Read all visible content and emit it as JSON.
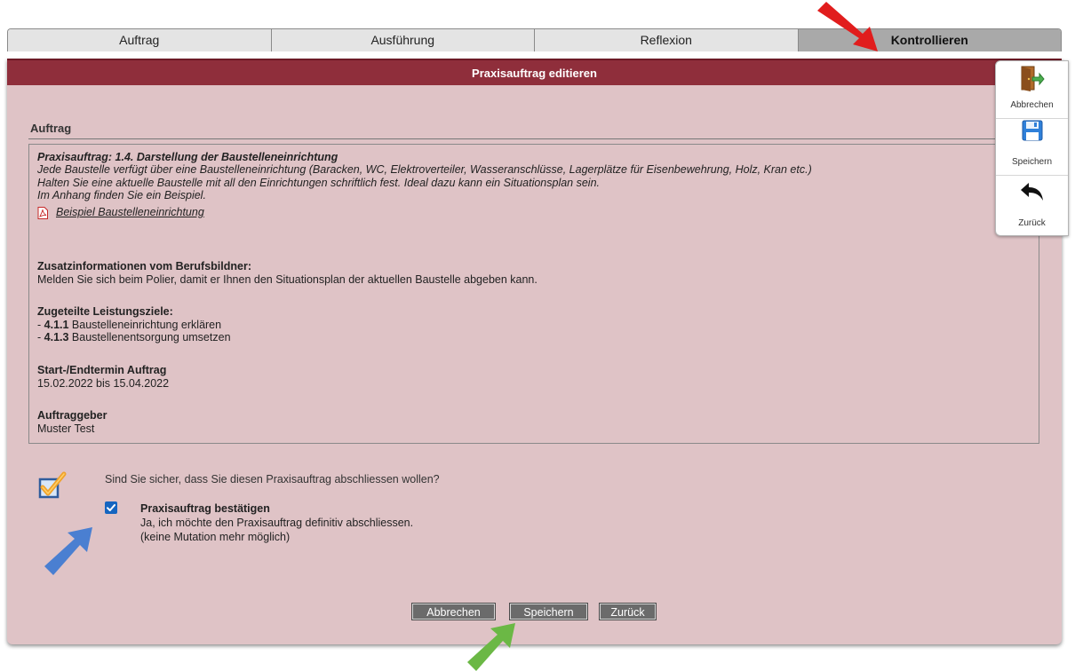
{
  "tabs": [
    {
      "label": "Auftrag"
    },
    {
      "label": "Ausführung"
    },
    {
      "label": "Reflexion"
    },
    {
      "label": "Kontrollieren"
    }
  ],
  "panel": {
    "title": "Praxisauftrag editieren",
    "section_title": "Auftrag"
  },
  "order": {
    "heading": "Praxisauftrag: 1.4. Darstellung der Baustelleneinrichtung",
    "desc_lines": [
      "Jede Baustelle verfügt über eine Baustelleneinrichtung (Baracken, WC, Elektroverteiler, Wasseranschlüsse, Lagerplätze für Eisenbewehrung, Holz, Kran etc.)",
      "Halten Sie eine aktuelle Baustelle mit all den Einrichtungen schriftlich fest. Ideal dazu kann ein Situationsplan sein.",
      "Im Anhang finden Sie ein Beispiel."
    ],
    "attachment": "Beispiel Baustelleneinrichtung",
    "extra_info_label": "Zusatzinformationen vom Berufsbildner:",
    "extra_info_text": "Melden Sie sich beim Polier, damit er Ihnen den Situationsplan der aktuellen Baustelle abgeben kann.",
    "goals_label": "Zugeteilte Leistungsziele:",
    "goals": [
      {
        "prefix": "- ",
        "code": "4.1.1",
        "text": " Baustelleneinrichtung erklären"
      },
      {
        "prefix": "- ",
        "code": "4.1.3",
        "text": " Baustellenentsorgung umsetzen"
      }
    ],
    "dates_label": "Start-/Endtermin Auftrag",
    "dates_value": "15.02.2022 bis 15.04.2022",
    "client_label": "Auftraggeber",
    "client_value": "Muster Test"
  },
  "confirm": {
    "question": "Sind Sie sicher, dass Sie diesen Praxisauftrag abschliessen wollen?",
    "checkbox_checked": true,
    "title": "Praxisauftrag bestätigen",
    "line1": "Ja, ich möchte den Praxisauftrag definitiv abschliessen.",
    "line2": "(keine Mutation mehr möglich)"
  },
  "buttons": {
    "cancel": "Abbrechen",
    "save": "Speichern",
    "back": "Zurück"
  },
  "side_panel": {
    "cancel": "Abbrechen",
    "save": "Speichern",
    "back": "Zurück"
  },
  "icons": {
    "side_cancel": "exit-door-icon",
    "side_save": "floppy-disk-icon",
    "side_back": "back-arrow-icon",
    "attachment": "pdf-icon",
    "confirm": "checkbox-check-icon"
  },
  "colors": {
    "header": "#8f2e3b",
    "panel": "#dfc3c6",
    "active_tab": "#a9a9a9",
    "button": "#6b6b6b",
    "checkbox": "#1565c0",
    "annotation_red": "#e11d1d",
    "annotation_blue": "#4a7fd1",
    "annotation_green": "#6bb845"
  }
}
